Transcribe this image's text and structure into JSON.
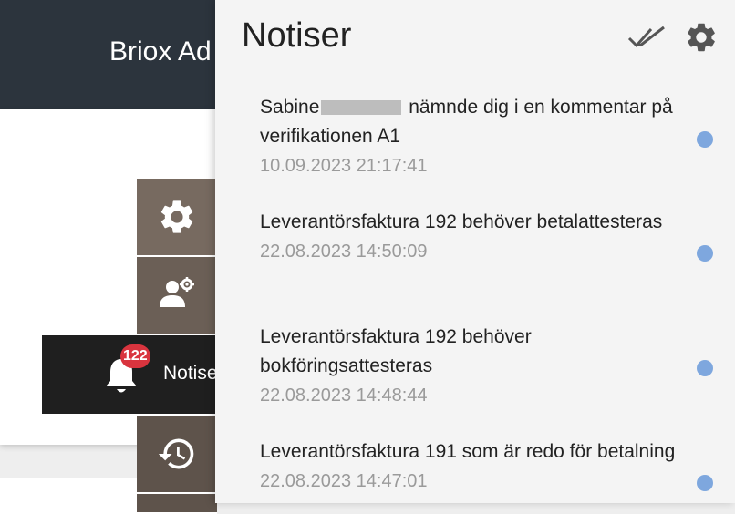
{
  "app": {
    "title": "Briox Ad"
  },
  "sidebar": {
    "notifications": {
      "label": "Notiser",
      "badge_count": "122"
    }
  },
  "panel": {
    "title": "Notiser",
    "items": [
      {
        "name_prefix": "Sabine",
        "text": "nämnde dig i en kommentar på verifikationen A1",
        "timestamp": "10.09.2023 21:17:41",
        "unread": true
      },
      {
        "text": "Leverantörsfaktura 192 behöver betalattesteras",
        "timestamp": "22.08.2023 14:50:09",
        "unread": true
      },
      {
        "text": "Leverantörsfaktura 192 behöver bokföringsattesteras",
        "timestamp": "22.08.2023 14:48:44",
        "unread": true
      },
      {
        "text": "Leverantörsfaktura 191 som är redo för betalning",
        "timestamp": "22.08.2023 14:47:01",
        "unread": true
      }
    ]
  },
  "colors": {
    "topbar": "#2c343d",
    "panel_bg": "#f4f4f4",
    "unread_dot": "#7ea7de",
    "badge": "#d9343e"
  }
}
